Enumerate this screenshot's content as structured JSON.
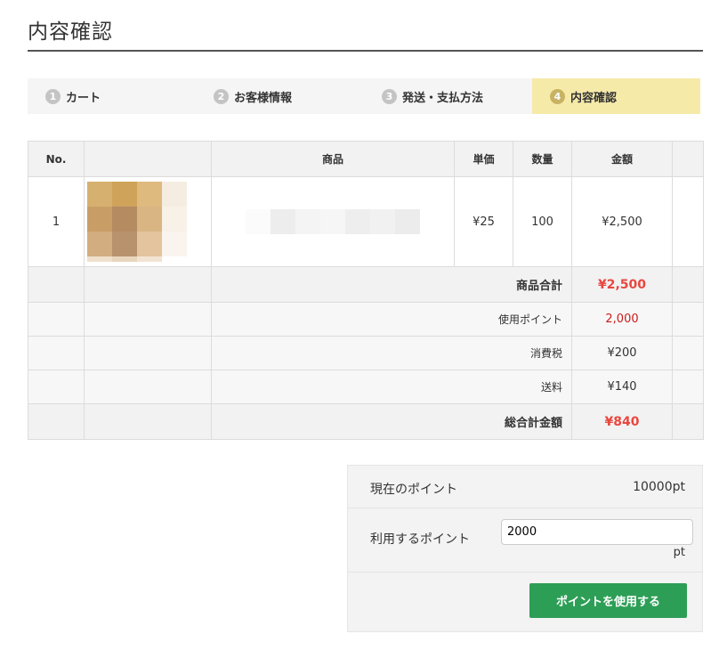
{
  "page": {
    "title": "内容確認"
  },
  "steps": [
    {
      "num": "1",
      "label": "カート"
    },
    {
      "num": "2",
      "label": "お客様情報"
    },
    {
      "num": "3",
      "label": "発送・支払方法"
    },
    {
      "num": "4",
      "label": "内容確認"
    }
  ],
  "active_step": 4,
  "table": {
    "headers": {
      "no": "No.",
      "image": "",
      "product": "商品",
      "unit_price": "単価",
      "quantity": "数量",
      "amount": "金額",
      "extra": ""
    },
    "items": [
      {
        "no": "1",
        "unit_price": "¥25",
        "quantity": "100",
        "amount": "¥2,500"
      }
    ],
    "subtotal": {
      "label": "商品合計",
      "value": "¥2,500"
    },
    "used_points": {
      "label": "使用ポイント",
      "value": "2,000"
    },
    "tax": {
      "label": "消費税",
      "value": "¥200"
    },
    "shipping": {
      "label": "送料",
      "value": "¥140"
    },
    "total": {
      "label": "総合計金額",
      "value": "¥840"
    }
  },
  "points": {
    "current_label": "現在のポイント",
    "current_value": "10000pt",
    "use_label": "利用するポイント",
    "use_value": "2000",
    "unit": "pt",
    "button_label": "ポイントを使用する"
  },
  "colors": {
    "accent_red": "#e8473f",
    "points_red": "#cc1b1b",
    "button_green": "#2d9e56",
    "active_step_bg": "#f6eaa9"
  }
}
